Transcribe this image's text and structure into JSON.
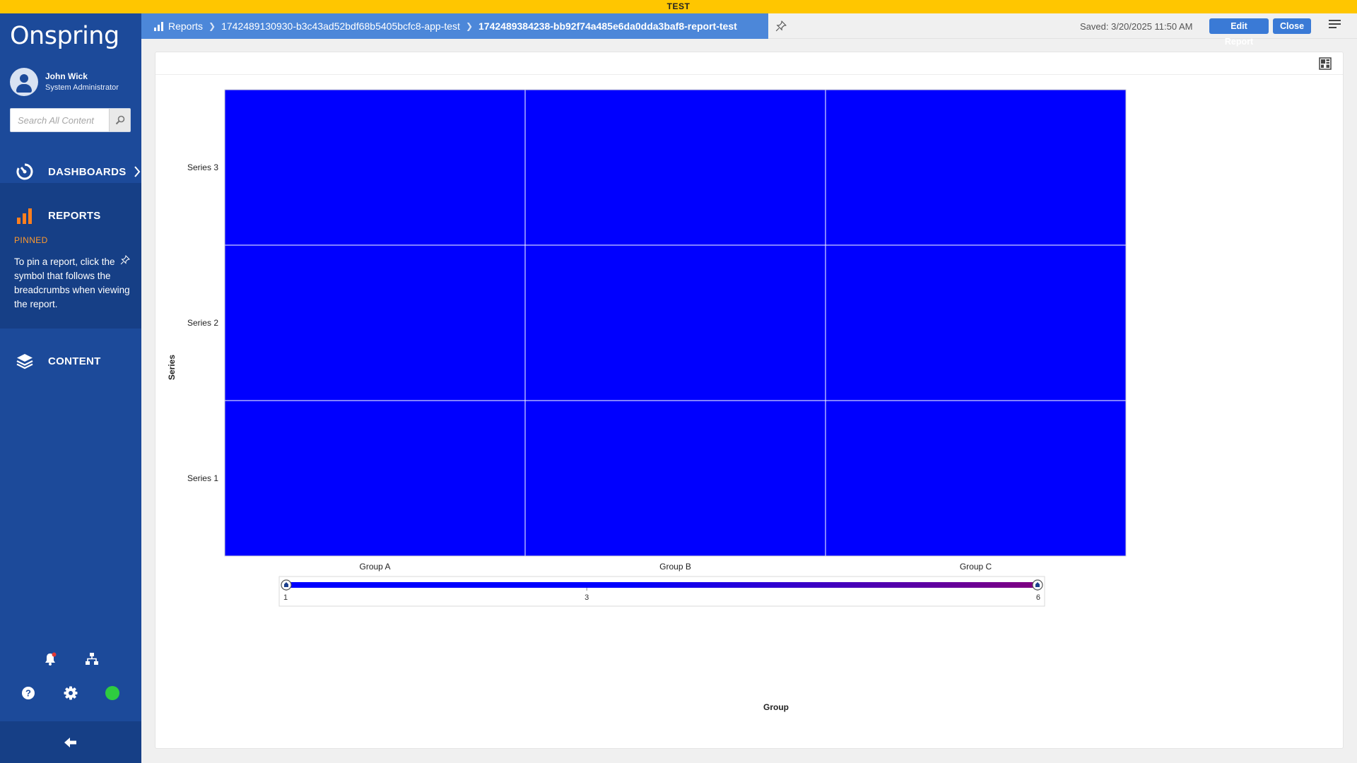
{
  "env_label": "TEST",
  "sidebar": {
    "logo": "Onspring",
    "user": {
      "name": "John Wick",
      "role": "System Administrator"
    },
    "search": {
      "placeholder": "Search All Content",
      "value": ""
    },
    "nav": {
      "dashboards": "DASHBOARDS",
      "reports": "REPORTS",
      "content": "CONTENT"
    },
    "pinned": {
      "heading": "PINNED",
      "text_before": "To pin a report, click the",
      "text_after": "symbol that follows the breadcrumbs when viewing the report."
    },
    "status_color": "#2ecc40"
  },
  "header": {
    "breadcrumbs": [
      "Reports",
      "1742489130930-b3c43ad52bdf68b5405bcfc8-app-test",
      "1742489384238-bb92f74a485e6da0dda3baf8-report-test"
    ],
    "saved": "Saved: 3/20/2025 11:50 AM",
    "edit_label": "Edit Report",
    "close_label": "Close"
  },
  "chart_data": {
    "type": "heatmap",
    "xlabel": "Group",
    "ylabel": "Series",
    "x": [
      "Group A",
      "Group B",
      "Group C"
    ],
    "y": [
      "Series 1",
      "Series 2",
      "Series 3"
    ],
    "values": [
      [
        1,
        1,
        1
      ],
      [
        1,
        1,
        1
      ],
      [
        1,
        1,
        1
      ]
    ],
    "cell_color": "#0000ff",
    "color_scale": {
      "min": 1,
      "max": 6,
      "ticks": [
        1,
        3,
        6
      ],
      "colors": [
        "#0000ff",
        "#800080"
      ]
    }
  }
}
